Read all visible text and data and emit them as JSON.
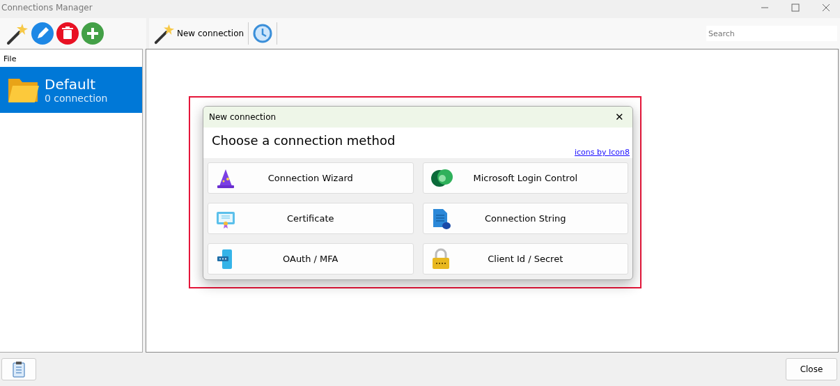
{
  "window": {
    "title": "Connections Manager"
  },
  "left_toolbar": {
    "buttons": [
      {
        "kind": "wand"
      },
      {
        "kind": "edit"
      },
      {
        "kind": "delete"
      },
      {
        "kind": "add"
      }
    ]
  },
  "main_toolbar": {
    "new_button": "New connection",
    "search": {
      "placeholder": "Search"
    }
  },
  "sidebar": {
    "header": "File",
    "items": [
      {
        "name": "Default",
        "count": "0 connection",
        "selected": true
      }
    ]
  },
  "dialog": {
    "title": "New connection",
    "close": "✕",
    "heading": "Choose a connection method",
    "credit_link": "icons by Icon8",
    "methods": [
      {
        "kind": "wizard",
        "label": "Connection Wizard"
      },
      {
        "kind": "microsoft",
        "label": "Microsoft Login Control"
      },
      {
        "kind": "certificate",
        "label": "Certificate"
      },
      {
        "kind": "string",
        "label": "Connection String"
      },
      {
        "kind": "oauth",
        "label": "OAuth / MFA"
      },
      {
        "kind": "secret",
        "label": "Client Id / Secret"
      }
    ]
  },
  "footer": {
    "close_button": "Close"
  }
}
